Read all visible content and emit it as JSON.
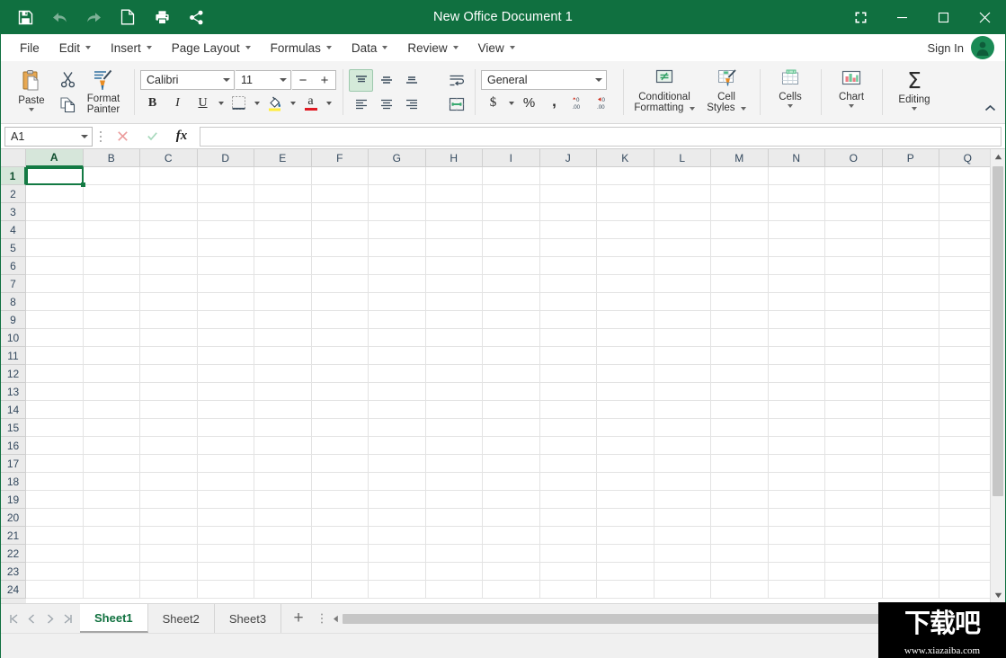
{
  "titlebar": {
    "title": "New Office Document 1",
    "quick_access": [
      {
        "name": "save-button",
        "icon": "save-icon",
        "disabled": false
      },
      {
        "name": "undo-button",
        "icon": "undo-icon",
        "disabled": true
      },
      {
        "name": "redo-button",
        "icon": "redo-icon",
        "disabled": true
      },
      {
        "name": "new-document-button",
        "icon": "new-document-icon",
        "disabled": false
      },
      {
        "name": "print-button",
        "icon": "print-icon",
        "disabled": false
      },
      {
        "name": "share-button",
        "icon": "share-icon",
        "disabled": false
      }
    ],
    "window_controls": [
      "fullscreen-icon",
      "minimize-icon",
      "maximize-icon",
      "close-icon"
    ],
    "accent_color": "#107040"
  },
  "menubar": {
    "items": [
      {
        "label": "File",
        "has_caret": false
      },
      {
        "label": "Edit",
        "has_caret": true
      },
      {
        "label": "Insert",
        "has_caret": true
      },
      {
        "label": "Page Layout",
        "has_caret": true
      },
      {
        "label": "Formulas",
        "has_caret": true
      },
      {
        "label": "Data",
        "has_caret": true
      },
      {
        "label": "Review",
        "has_caret": true
      },
      {
        "label": "View",
        "has_caret": true
      }
    ],
    "sign_in_label": "Sign In"
  },
  "ribbon": {
    "clipboard": {
      "paste_label": "Paste",
      "format_painter_label": "Format Painter"
    },
    "font": {
      "font_name": "Calibri",
      "font_size": "11",
      "decrease_size": "−",
      "increase_size": "+",
      "bold": "B",
      "italic": "I",
      "underline": "U",
      "font_color_letter": "a"
    },
    "number": {
      "format": "General",
      "currency": "$",
      "percent": "%",
      "comma": ",",
      "increase_decimal": ".00",
      "decrease_decimal": ".00"
    },
    "styles": {
      "conditional_formatting_line1": "Conditional",
      "conditional_formatting_line2": "Formatting",
      "cell_styles_line1": "Cell",
      "cell_styles_line2": "Styles"
    },
    "cells_label": "Cells",
    "chart_label": "Chart",
    "editing_label": "Editing"
  },
  "formulabar": {
    "name_box_value": "A1",
    "formula_value": ""
  },
  "grid": {
    "columns": [
      "A",
      "B",
      "C",
      "D",
      "E",
      "F",
      "G",
      "H",
      "I",
      "J",
      "K",
      "L",
      "M",
      "N",
      "O",
      "P",
      "Q"
    ],
    "rows": [
      1,
      2,
      3,
      4,
      5,
      6,
      7,
      8,
      9,
      10,
      11,
      12,
      13,
      14,
      15,
      16,
      17,
      18,
      19,
      20,
      21,
      22,
      23,
      24
    ],
    "selected_cell": "A1",
    "selected_column": "A",
    "selected_row": 1
  },
  "sheetbar": {
    "tabs": [
      {
        "label": "Sheet1",
        "active": true
      },
      {
        "label": "Sheet2",
        "active": false
      },
      {
        "label": "Sheet3",
        "active": false
      }
    ],
    "add_sheet_label": "+"
  },
  "watermark": {
    "cn_text": "下载吧",
    "url_text": "www.xiazaiba.com"
  }
}
